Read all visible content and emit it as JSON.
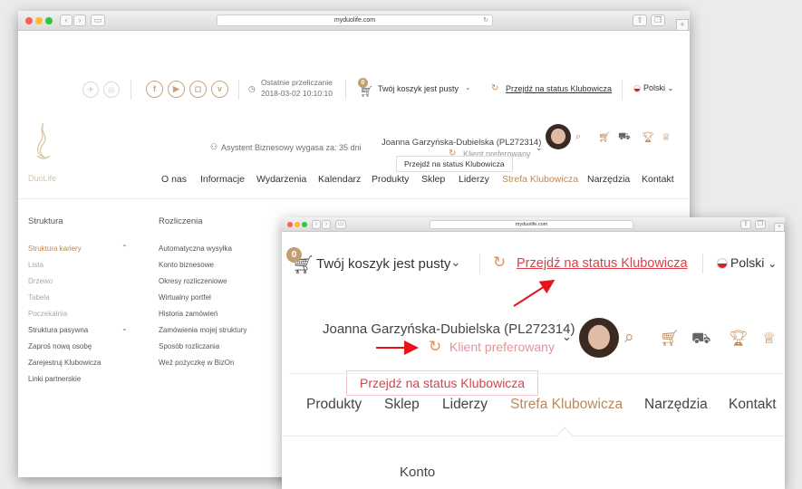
{
  "browser": {
    "url": "myduolife.com",
    "url_small": "myduolife.com"
  },
  "header": {
    "last_calc_label": "Ostatnie przeliczanie",
    "last_calc_value": "2018-03-02 10:10:10",
    "cart_count": "0",
    "cart_label": "Twój koszyk jest pusty",
    "club_link": "Przejdź na status Klubowicza",
    "language": "Polski",
    "assistant_expiry": "Asystent Biznesowy wygasa za: 35 dni",
    "user_name": "Joanna Garzyńska-Dubielska (PL272314)",
    "user_status": "Klient preferowany",
    "tooltip": "Przejdź na status Klubowicza",
    "logo_text": "DuoLife"
  },
  "nav": {
    "items": [
      "O nas",
      "Informacje",
      "Wydarzenia",
      "Kalendarz",
      "Produkty",
      "Sklep",
      "Liderzy",
      "Strefa Klubowicza",
      "Narzędzia",
      "Kontakt"
    ],
    "active": "Strefa Klubowicza"
  },
  "menu": {
    "col1_title": "Struktura",
    "col1_items": [
      "Struktura kariery",
      "Lista",
      "Drzewo",
      "Tabela",
      "Poczekalnia",
      "Struktura pasywna",
      "Zaproś nową osobę",
      "Zarejestruj Klubowicza",
      "Linki partnerskie"
    ],
    "col2_title": "Rozliczenia",
    "col2_items": [
      "Automatyczna wysyłka",
      "Konto biznesowe",
      "Okresy rozliczeniowe",
      "Wirtualny portfel",
      "Historia zamówień",
      "Zamówienia mojej struktury",
      "Sposób rozliczania",
      "Weź pożyczkę w BizOn"
    ]
  },
  "zoom": {
    "nav_items": [
      "Produkty",
      "Sklep",
      "Liderzy",
      "Strefa Klubowicza",
      "Narzędzia",
      "Kontakt"
    ],
    "section_title": "Konto"
  },
  "colors": {
    "accent": "#b9895a",
    "arrow": "#e8141b",
    "link": "#d8424d"
  }
}
